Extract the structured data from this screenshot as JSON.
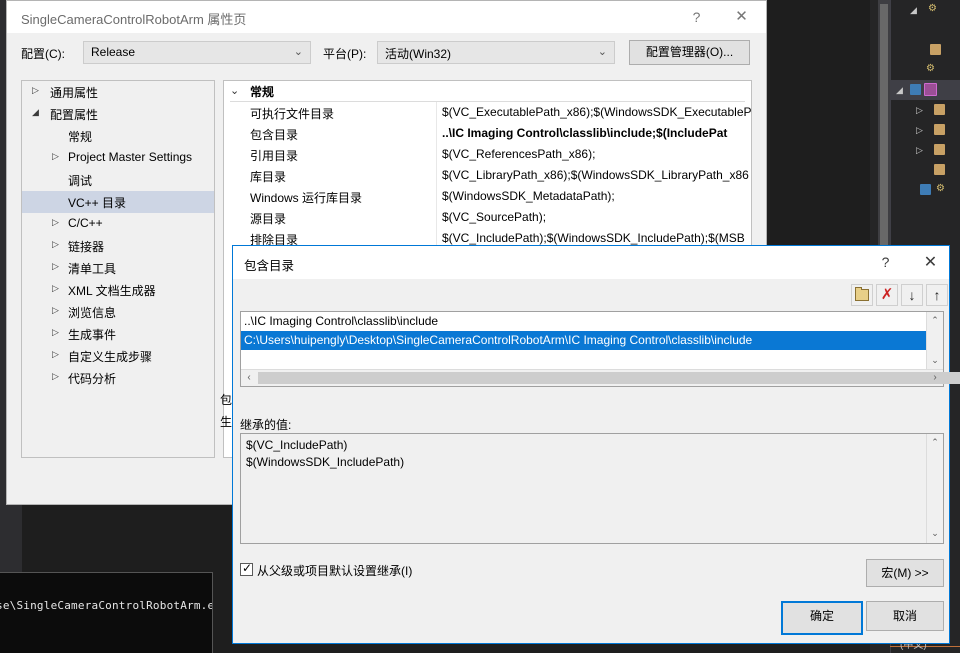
{
  "ide": {
    "console_text": "se\\SingleCameraControlRobotArm.exe",
    "taskbar_fragment": "(中文)"
  },
  "property_pages": {
    "title": "SingleCameraControlRobotArm 属性页",
    "help_icon": "?",
    "close_icon": "✕",
    "config_label": "配置(C):",
    "config_value": "Release",
    "platform_label": "平台(P):",
    "platform_value": "活动(Win32)",
    "config_manager_button": "配置管理器(O)...",
    "chevron": "⌄",
    "tree": [
      {
        "label": "通用属性",
        "arrow": "▷",
        "indent": 10,
        "level": 0,
        "selected": false
      },
      {
        "label": "配置属性",
        "arrow": "◢",
        "indent": 10,
        "level": 0,
        "selected": false
      },
      {
        "label": "常规",
        "arrow": "",
        "indent": 28,
        "level": 1,
        "selected": false
      },
      {
        "label": "Project Master Settings",
        "arrow": "▷",
        "indent": 28,
        "level": 1,
        "selected": false
      },
      {
        "label": "调试",
        "arrow": "",
        "indent": 28,
        "level": 1,
        "selected": false
      },
      {
        "label": "VC++ 目录",
        "arrow": "",
        "indent": 28,
        "level": 1,
        "selected": true
      },
      {
        "label": "C/C++",
        "arrow": "▷",
        "indent": 28,
        "level": 1,
        "selected": false
      },
      {
        "label": "链接器",
        "arrow": "▷",
        "indent": 28,
        "level": 1,
        "selected": false
      },
      {
        "label": "清单工具",
        "arrow": "▷",
        "indent": 28,
        "level": 1,
        "selected": false
      },
      {
        "label": "XML 文档生成器",
        "arrow": "▷",
        "indent": 28,
        "level": 1,
        "selected": false
      },
      {
        "label": "浏览信息",
        "arrow": "▷",
        "indent": 28,
        "level": 1,
        "selected": false
      },
      {
        "label": "生成事件",
        "arrow": "▷",
        "indent": 28,
        "level": 1,
        "selected": false
      },
      {
        "label": "自定义生成步骤",
        "arrow": "▷",
        "indent": 28,
        "level": 1,
        "selected": false
      },
      {
        "label": "代码分析",
        "arrow": "▷",
        "indent": 28,
        "level": 1,
        "selected": false
      }
    ],
    "group": {
      "chevron": "⌄",
      "title": "常规"
    },
    "rows": [
      {
        "name": "可执行文件目录",
        "value": "$(VC_ExecutablePath_x86);$(WindowsSDK_ExecutableP",
        "bold": false
      },
      {
        "name": "包含目录",
        "value": "..\\IC Imaging Control\\classlib\\include;$(IncludePat",
        "bold": true
      },
      {
        "name": "引用目录",
        "value": "$(VC_ReferencesPath_x86);",
        "bold": false
      },
      {
        "name": "库目录",
        "value": "$(VC_LibraryPath_x86);$(WindowsSDK_LibraryPath_x86",
        "bold": false
      },
      {
        "name": "Windows 运行库目录",
        "value": "$(WindowsSDK_MetadataPath);",
        "bold": false
      },
      {
        "name": "源目录",
        "value": "$(VC_SourcePath);",
        "bold": false
      },
      {
        "name": "排除目录",
        "value": "$(VC_IncludePath);$(WindowsSDK_IncludePath);$(MSB",
        "bold": false
      }
    ],
    "behind_labels": [
      "包",
      "生"
    ]
  },
  "include_dialog": {
    "title": "包含目录",
    "help_icon": "?",
    "close_icon": "✕",
    "toolbar": [
      {
        "name": "new-folder",
        "glyph": ""
      },
      {
        "name": "delete",
        "glyph": "✗"
      },
      {
        "name": "move-down",
        "glyph": "↓"
      },
      {
        "name": "move-up",
        "glyph": "↑"
      }
    ],
    "list_items": [
      {
        "text": "..\\IC Imaging Control\\classlib\\include",
        "selected": false
      },
      {
        "text": "C:\\Users\\huipengly\\Desktop\\SingleCameraControlRobotArm\\IC Imaging Control\\classlib\\include",
        "selected": true
      }
    ],
    "scroll_up": "⌃",
    "scroll_down": "⌄",
    "scroll_left": "‹",
    "scroll_right": "›",
    "inherited_label": "继承的值:",
    "inherited_values": [
      "$(VC_IncludePath)",
      "$(WindowsSDK_IncludePath)"
    ],
    "inherit_checkbox_label": "从父级或项目默认设置继承(I)",
    "inherit_checked": true,
    "checkbox_tick": "✓",
    "macro_button": "宏(M) >>",
    "ok_button": "确定",
    "cancel_button": "取消"
  },
  "colors": {
    "accent_blue": "#0078d7",
    "selection_blue": "#0a78d4",
    "tree_selection": "#cdd5e4",
    "dialog_bg": "#f0f0f0"
  }
}
